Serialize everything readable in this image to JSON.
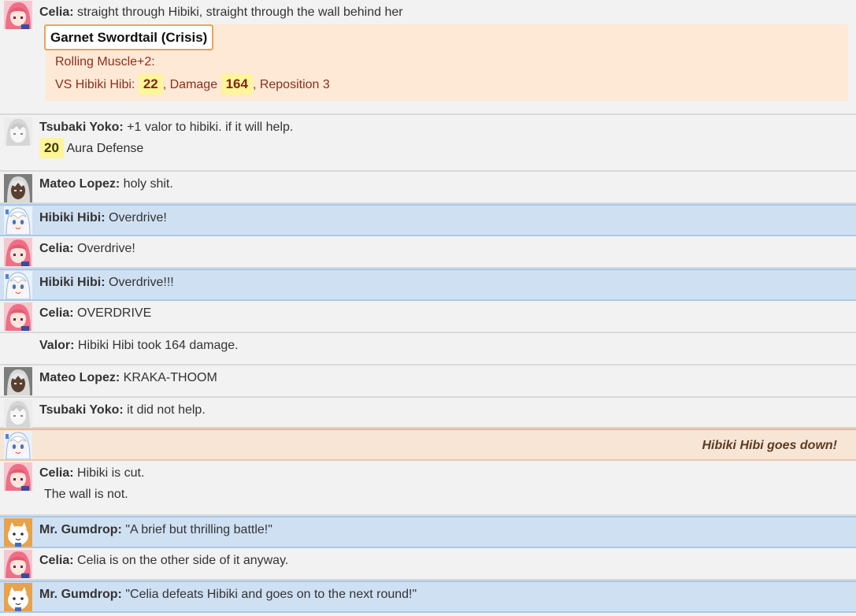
{
  "colors": {
    "background": "#f2f2f2",
    "highlight_blue": "#cfe0f3",
    "roll_box": "#fde9d6",
    "roll_border": "#e8a35c",
    "badge_yellow": "#fff59a",
    "knockout_peach": "#f7e5d6"
  },
  "messages": [
    {
      "speaker": "Celia:",
      "text": "straight through Hibiki, straight through the wall behind her",
      "roll": {
        "title": "Garnet Swordtail (Crisis)",
        "line1": "Rolling Muscle+2:",
        "vs_label": "VS Hibiki Hibi:",
        "vs_value": "22",
        "damage_label": ", Damage",
        "damage_value": "164",
        "reposition": ", Reposition 3"
      }
    },
    {
      "speaker": "Tsubaki Yoko:",
      "text": "+1 valor to hibiki. if it will help.",
      "defense_value": "20",
      "defense_label": "Aura Defense"
    },
    {
      "speaker": "Mateo Lopez:",
      "text": "holy shit."
    },
    {
      "speaker": "Hibiki Hibi:",
      "text": "Overdrive!"
    },
    {
      "speaker": "Celia:",
      "text": "Overdrive!"
    },
    {
      "speaker": "Hibiki Hibi:",
      "text": "Overdrive!!!"
    },
    {
      "speaker": "Celia:",
      "text": "OVERDRIVE"
    },
    {
      "speaker": "Valor:",
      "text": "Hibiki Hibi took 164 damage."
    },
    {
      "speaker": "Mateo Lopez:",
      "text": "KRAKA-THOOM"
    },
    {
      "speaker": "Tsubaki Yoko:",
      "text": "it did not help."
    },
    {
      "status": "Hibiki Hibi goes down!"
    },
    {
      "speaker": "Celia:",
      "text": "Hibiki is cut.",
      "continuation": "The wall is not."
    },
    {
      "speaker": "Mr. Gumdrop:",
      "text": "\"A brief but thrilling battle!\""
    },
    {
      "speaker": "Celia:",
      "text": "Celia is on the other side of it anyway."
    },
    {
      "speaker": "Mr. Gumdrop:",
      "text": "\"Celia defeats Hibiki and goes on to the next round!\""
    }
  ],
  "avatars": {
    "celia": "celia-avatar-icon",
    "tsubaki": "tsubaki-avatar-icon",
    "mateo": "mateo-avatar-icon",
    "hibiki": "hibiki-avatar-icon",
    "gumdrop": "gumdrop-avatar-icon"
  }
}
